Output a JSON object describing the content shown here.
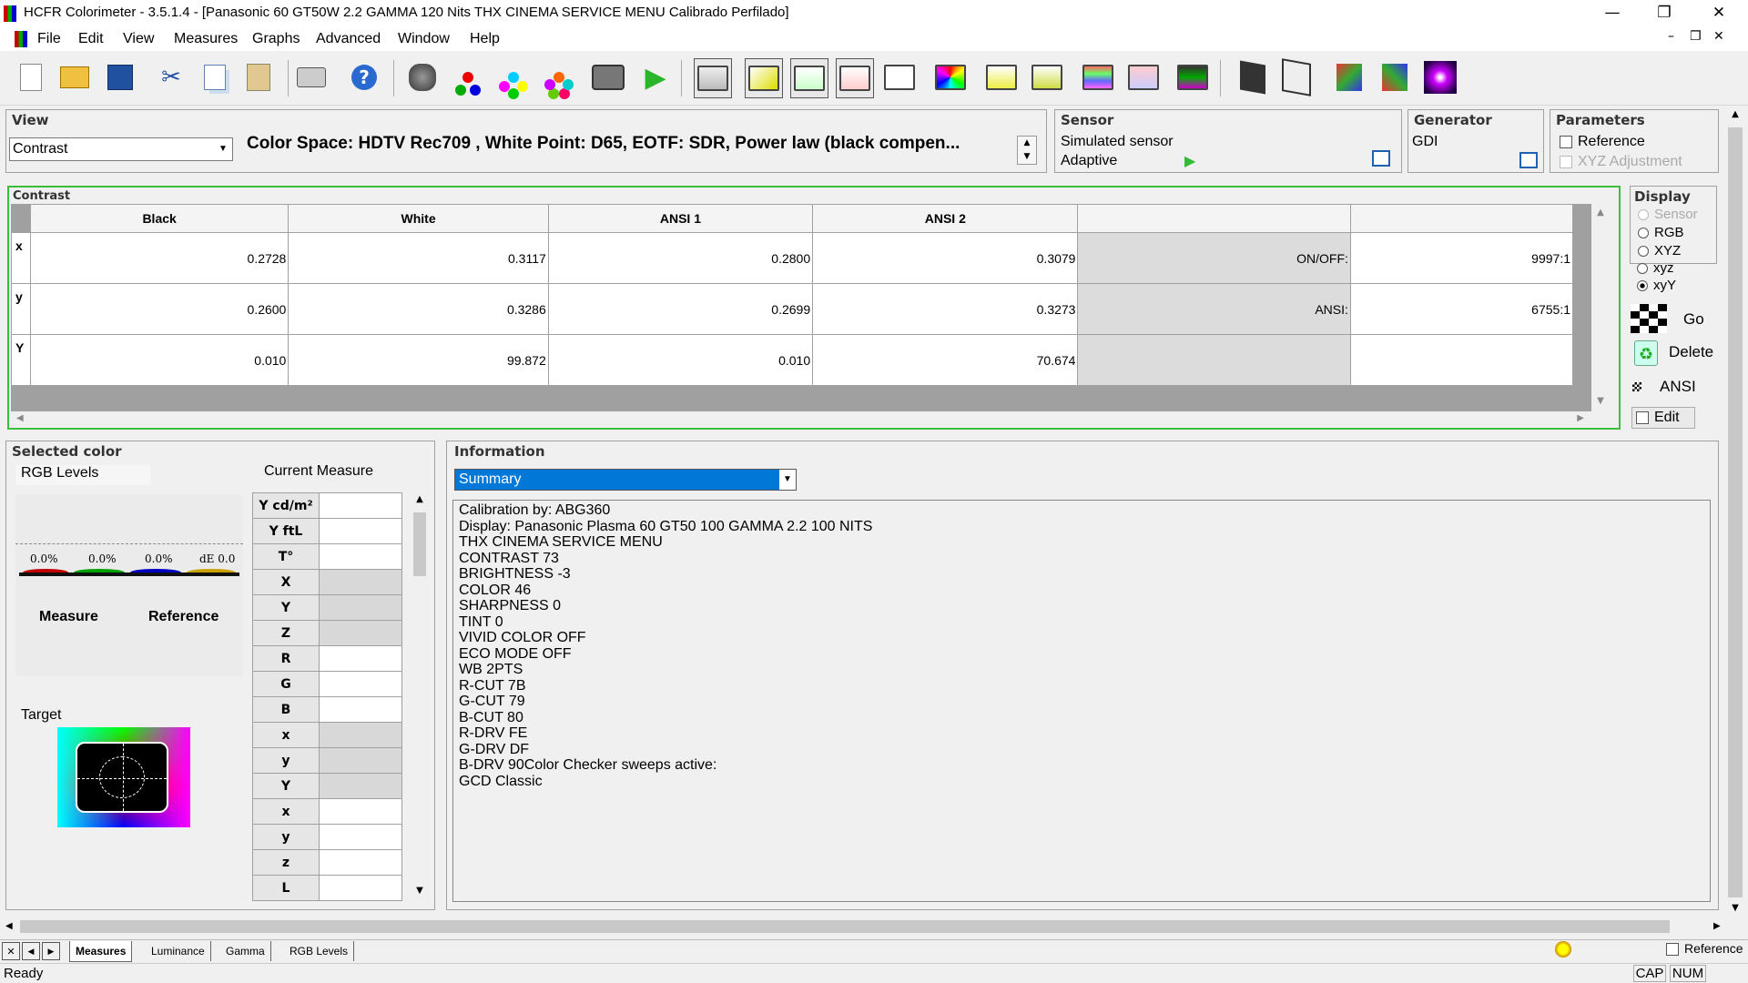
{
  "window": {
    "title": "HCFR Colorimeter - 3.5.1.4 - [Panasonic 60 GT50W 2.2 GAMMA 120 Nits THX CINEMA SERVICE MENU Calibrado Perfilado]",
    "minimize": "—",
    "restore": "❐",
    "close": "✕",
    "mdi_minimize": "–",
    "mdi_restore": "❐",
    "mdi_close": "✕"
  },
  "menu": {
    "file": "File",
    "edit": "Edit",
    "view": "View",
    "measures": "Measures",
    "graphs": "Graphs",
    "advanced": "Advanced",
    "window": "Window",
    "help": "Help"
  },
  "toolbar_icons": [
    "new-icon",
    "open-icon",
    "save-icon",
    "cut-icon",
    "copy-icon",
    "paste-icon",
    "print-icon",
    "help-icon",
    "sensor-icon",
    "rgb-balls-icon",
    "color-balls-icon",
    "saturation-balls-icon",
    "camera-icon",
    "play-icon",
    "monitor-1-icon",
    "monitor-2-icon",
    "monitor-3-icon",
    "monitor-4-icon",
    "monitor-5-icon",
    "monitor-6-icon",
    "monitor-7-icon",
    "monitor-8-icon",
    "monitor-9-icon",
    "monitor-10-icon",
    "monitor-11-icon",
    "film-1-icon",
    "film-2-icon",
    "cube-1-icon",
    "cube-2-icon",
    "burst-icon"
  ],
  "view_panel": {
    "title": "View",
    "selected": "Contrast",
    "description": "Color Space: HDTV Rec709 , White Point: D65, EOTF:  SDR, Power law (black compen..."
  },
  "sensor_panel": {
    "title": "Sensor",
    "sensor_name": "Simulated sensor",
    "mode": "Adaptive"
  },
  "generator_panel": {
    "title": "Generator",
    "name": "GDI"
  },
  "parameters_panel": {
    "title": "Parameters",
    "reference": "Reference",
    "xyz_adjustment": "XYZ Adjustment"
  },
  "contrast": {
    "title": "Contrast",
    "headers": [
      "Black",
      "White",
      "ANSI 1",
      "ANSI 2",
      "",
      ""
    ],
    "rows": [
      {
        "label": "x",
        "values": [
          "0.2728",
          "0.3117",
          "0.2800",
          "0.3079"
        ],
        "metric": "ON/OFF:",
        "metric_value": "9997:1"
      },
      {
        "label": "y",
        "values": [
          "0.2600",
          "0.3286",
          "0.2699",
          "0.3273"
        ],
        "metric": "ANSI:",
        "metric_value": "6755:1"
      },
      {
        "label": "Y",
        "values": [
          "0.010",
          "99.872",
          "0.010",
          "70.674"
        ],
        "metric": "",
        "metric_value": ""
      }
    ]
  },
  "display_panel": {
    "title": "Display",
    "options": [
      "Sensor",
      "RGB",
      "XYZ",
      "xyz",
      "xyY"
    ],
    "selected": "xyY",
    "go": "Go",
    "delete": "Delete",
    "ansi": "ANSI",
    "edit": "Edit"
  },
  "selected_color": {
    "title": "Selected color",
    "rgb_levels": "RGB Levels",
    "current_measure": "Current Measure",
    "bars": [
      {
        "label": "0.0%",
        "color": "#c00000"
      },
      {
        "label": "0.0%",
        "color": "#00a000"
      },
      {
        "label": "0.0%",
        "color": "#0000c0"
      },
      {
        "label": "dE 0.0",
        "color": "#c8a000"
      }
    ],
    "measure": "Measure",
    "reference": "Reference",
    "target": "Target",
    "measure_rows": [
      "Y cd/m²",
      "Y ftL",
      "T°",
      "X",
      "Y",
      "Z",
      "R",
      "G",
      "B",
      "x",
      "y",
      "Y",
      "x",
      "y",
      "z",
      "L"
    ],
    "grey_rows": [
      3,
      4,
      5,
      9,
      10,
      11
    ]
  },
  "information": {
    "title": "Information",
    "selected": "Summary",
    "text": "Calibration by: ABG360\nDisplay: Panasonic Plasma 60 GT50 100 GAMMA 2.2 100 NITS\nTHX CINEMA SERVICE MENU\nCONTRAST 73\nBRIGHTNESS -3\nCOLOR 46\nSHARPNESS 0\nTINT 0\nVIVID COLOR OFF\nECO MODE OFF\nWB 2PTS\nR-CUT 7B\nG-CUT 79\nB-CUT 80\nR-DRV FE\nG-DRV DF\nB-DRV 90Color Checker sweeps active:\nGCD Classic"
  },
  "tabs": [
    "Measures",
    "Luminance",
    "Gamma",
    "RGB Levels"
  ],
  "tab_nav": [
    "✕",
    "◀",
    "▶"
  ],
  "status": {
    "text": "Ready",
    "reference": "Reference",
    "cap": "CAP",
    "num": "NUM"
  }
}
